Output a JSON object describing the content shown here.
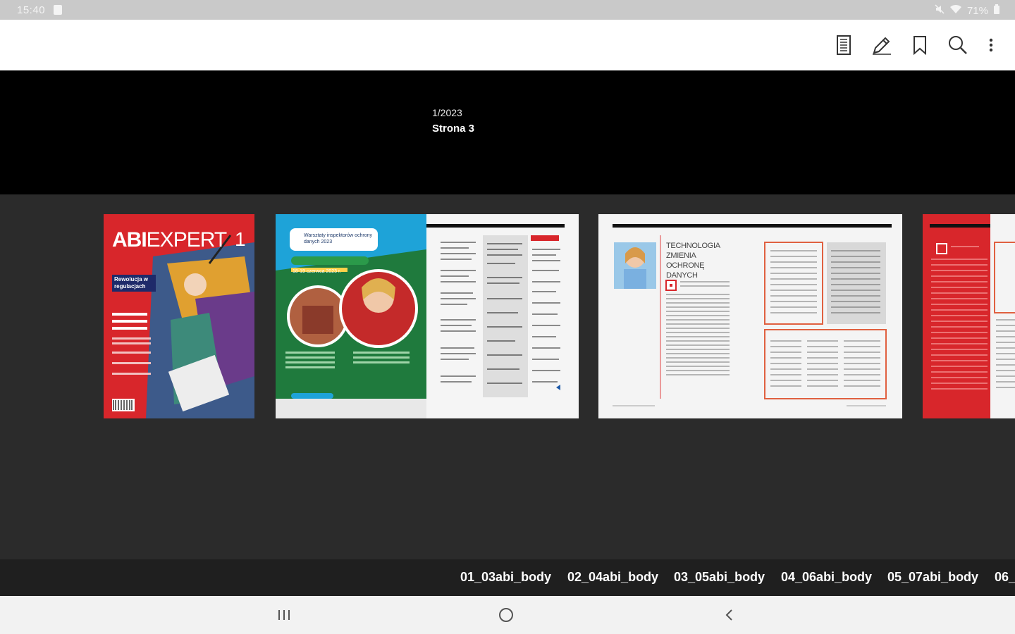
{
  "status": {
    "time": "15:40",
    "battery": "71%"
  },
  "toolbar": {
    "icons": [
      "contents-icon",
      "pencil-icon",
      "bookmark-icon",
      "search-icon",
      "more-vert-icon"
    ]
  },
  "issue": {
    "number": "1/2023",
    "page": "Strona 3"
  },
  "thumbnails": {
    "cover": {
      "brand_a": "ABI",
      "brand_b": "EXPERT",
      "issue_num": "1",
      "tag": "Rewolucja w regulacjach"
    },
    "spread2": {
      "title": "Warsztaty inspektorów ochrony danych 2023",
      "badge": "Warsztaty inspektorów ochrony danych 2023",
      "green_tag": "18-19 czerwca 2023 r."
    },
    "spread3": {
      "headline": "TECHNOLOGIA ZMIENIA OCHRONĘ DANYCH"
    }
  },
  "page_labels": [
    "01_03abi_body",
    "02_04abi_body",
    "03_05abi_body",
    "04_06abi_body",
    "05_07abi_body",
    "06_"
  ],
  "colors": {
    "accent_red": "#d8262b",
    "green": "#1f7a3d",
    "teal": "#1ea3d8"
  }
}
